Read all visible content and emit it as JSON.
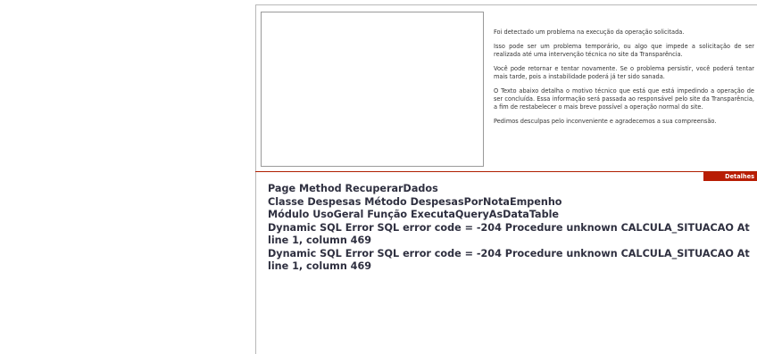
{
  "message": {
    "p1": "Foi detectado um problema na execução da operação solicitada.",
    "p2": "Isso pode ser um problema temporário, ou algo que impede a solicitação de ser realizada até uma intervenção técnica no site da Transparência.",
    "p3": "Você pode retornar e tentar novamente. Se o problema persistir, você poderá tentar mais tarde, pois a instabilidade poderá já ter sido sanada.",
    "p4": "O Texto abaixo detalha o motivo técnico que está que está impedindo a operação de ser concluída. Essa informação será passada ao responsável pelo site da Transparência, a fim de restabelecer o mais breve possível a operação normal do site.",
    "p5": "Pedimos desculpas pelo inconveniente e agradecemos a sua compreensão."
  },
  "details_tab": {
    "label": "Detalhes"
  },
  "details": {
    "line1": "Page Method RecuperarDados",
    "line2": "Classe Despesas Método DespesasPorNotaEmpenho",
    "line3": "Módulo UsoGeral Função ExecutaQueryAsDataTable",
    "line4": "Dynamic SQL Error SQL error code = -204 Procedure unknown CALCULA_SITUACAO At line 1, column 469",
    "line5": "Dynamic SQL Error SQL error code = -204 Procedure unknown CALCULA_SITUACAO At line 1, column 469"
  }
}
